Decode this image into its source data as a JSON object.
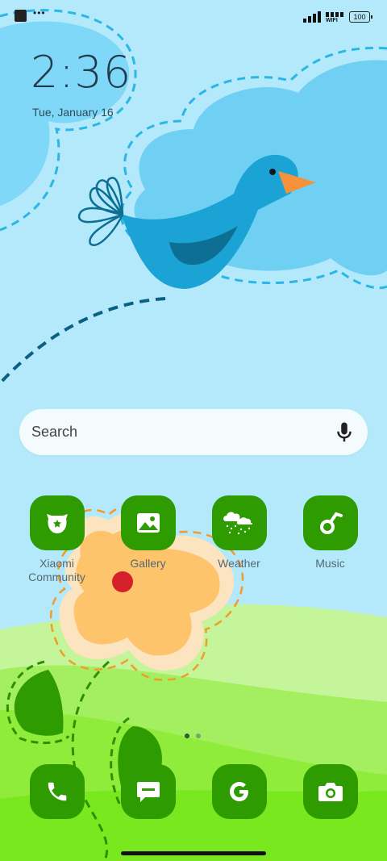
{
  "status_bar": {
    "notification_icon": "square-app-icon",
    "more_indicator": "•••",
    "wifi_label": "WIFI",
    "battery": "100"
  },
  "lock": {
    "time": "2:36",
    "date": "Tue, January 16"
  },
  "search": {
    "placeholder": "Search",
    "mic_icon": "microphone-icon"
  },
  "apps": [
    {
      "label": "Xiaomi Community",
      "icon": "mi-community-icon"
    },
    {
      "label": "Gallery",
      "icon": "gallery-icon"
    },
    {
      "label": "Weather",
      "icon": "weather-icon"
    },
    {
      "label": "Music",
      "icon": "music-icon"
    }
  ],
  "dock": [
    {
      "name": "Phone",
      "icon": "phone-icon"
    },
    {
      "name": "Messages",
      "icon": "message-icon"
    },
    {
      "name": "Google",
      "icon": "google-icon"
    },
    {
      "name": "Camera",
      "icon": "camera-icon"
    }
  ],
  "page_indicator": {
    "pages": 2,
    "current": 1
  },
  "colors": {
    "sky": "#b4e9fb",
    "cloud": "#6fd0f4",
    "bird": "#1aa3d4",
    "beak": "#f5913a",
    "hill_light": "#c4f59a",
    "hill_green": "#7ae81f",
    "flower": "#fdc46c",
    "app_green": "#2e9b00"
  }
}
